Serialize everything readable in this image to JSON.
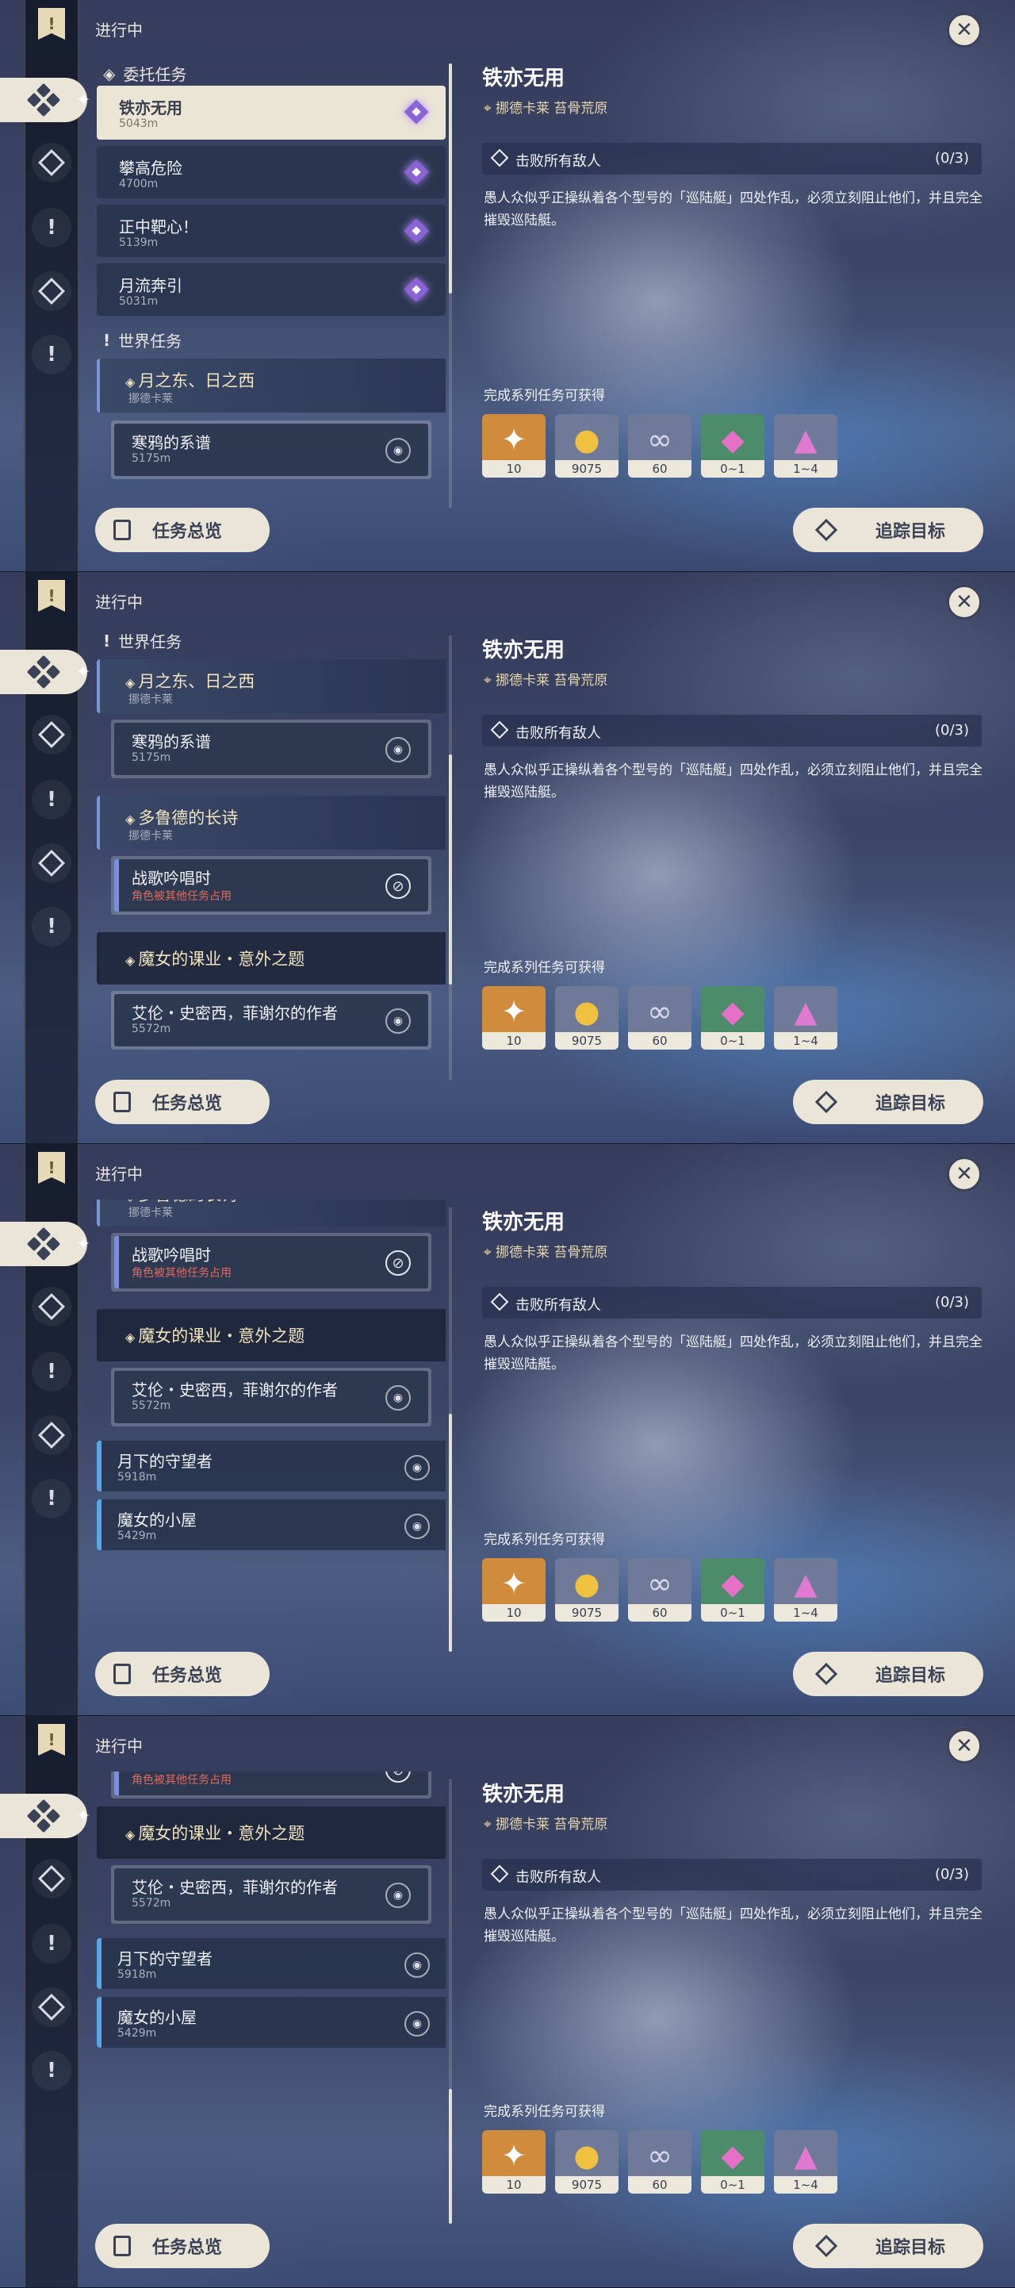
{
  "ui": {
    "section_in_progress": "进行中",
    "overview_button": "任务总览",
    "track_button": "追踪目标",
    "close_icon": "close-icon"
  },
  "nav": {
    "icons": [
      "quest-banner-icon",
      "all-quests-icon",
      "archon-quest-icon",
      "world-quest-icon",
      "commission-icon",
      "exclamation-quest-icon"
    ]
  },
  "lists": {
    "commission_header": "委托任务",
    "world_header": "世界任务",
    "commissions": [
      {
        "title": "铁亦无用",
        "dist": "5043m"
      },
      {
        "title": "攀高危险",
        "dist": "4700m"
      },
      {
        "title": "正中靶心！",
        "dist": "5139m"
      },
      {
        "title": "月流奔引",
        "dist": "5031m"
      }
    ],
    "world": {
      "q1": {
        "title": "月之东、日之西",
        "region": "挪德卡莱"
      },
      "q1_sub": {
        "title": "寒鸦的系谱",
        "dist": "5175m"
      },
      "q2": {
        "title": "多鲁德的长诗",
        "region": "挪德卡莱"
      },
      "q2_sub": {
        "title": "战歌吟唱时",
        "status": "角色被其他任务占用"
      },
      "q3": {
        "title": "魔女的课业・意外之题"
      },
      "q3_sub": {
        "title": "艾伦・史密西，菲谢尔的作者",
        "dist": "5572m"
      },
      "q4": {
        "title": "月下的守望者",
        "dist": "5918m"
      },
      "q5": {
        "title": "魔女的小屋",
        "dist": "5429m"
      }
    }
  },
  "detail": {
    "title": "铁亦无用",
    "location": "挪德卡莱 苔骨荒原",
    "objective": "击败所有敌人",
    "progress": "(0/3)",
    "description": "愚人众似乎正操纵着各个型号的「巡陆艇」四处作乱，必须立刻阻止他们，并且完全摧毁巡陆艇。",
    "reward_title": "完成系列任务可获得",
    "rewards": [
      {
        "icon": "primogem-icon",
        "amount": "10",
        "color": "#d08c3c"
      },
      {
        "icon": "mora-icon",
        "amount": "9075",
        "color": "#6f7a98"
      },
      {
        "icon": "exp-ring-icon",
        "amount": "60",
        "color": "#6f7a98"
      },
      {
        "icon": "pink-crystal-icon",
        "amount": "0~1",
        "color": "#4d8c6a"
      },
      {
        "icon": "crystal-cluster-icon",
        "amount": "1~4",
        "color": "#6f7a98"
      }
    ]
  }
}
